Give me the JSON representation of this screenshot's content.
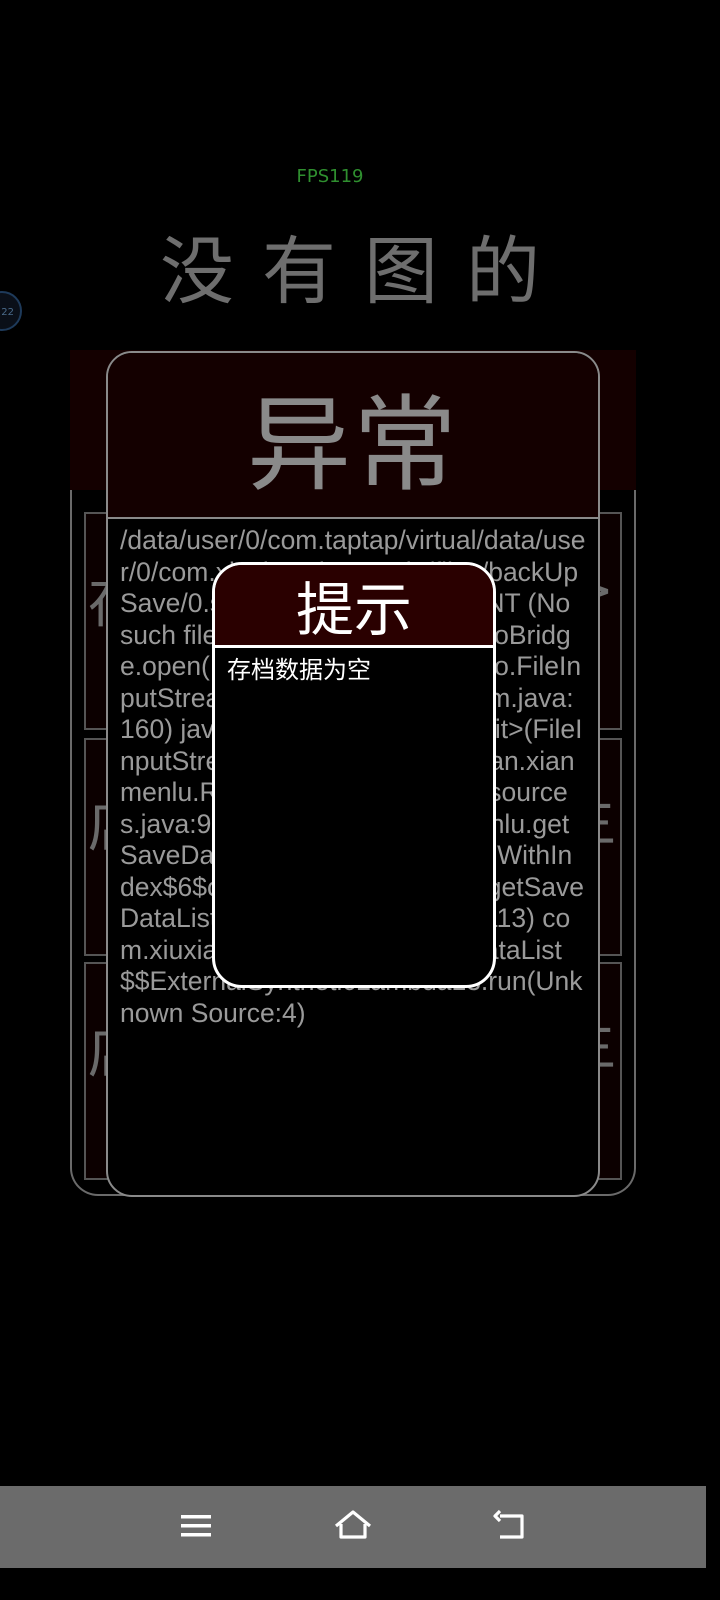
{
  "status": {
    "fps": "FPS119",
    "side_badge": "22"
  },
  "background": {
    "title": "没有图的",
    "cards": [
      {
        "left_char": "存",
        "right_char": ">"
      },
      {
        "left_char": "店",
        "right_char": "主"
      },
      {
        "left_char": "店",
        "right_char": "主"
      }
    ]
  },
  "error_panel": {
    "title": "异常",
    "message": "/data/user/0/com.taptap/virtual/data/user/0/com.xiuxian.xianmenlu/files/backUpSave/0.sav: open failed: ENOENT (No such file or directory) libcore.io.IoBridge.open(IoBridge.java:574) java.io.FileInputStream.<init>(FileInputStream.java:160) java.io.FileInputStream.<init>(FileInputStream.java:115) com.xiuxian.xianmenlu.Resources.getPlayer(Resources.java:976) com.xiuxian.xianmenlu.getSaveDataList.lambda$loadSaveWithIndex$6$com-xiuxian-xianmenlu-getSaveDataList(getSaveDataList.java:113) com.xiuxian.xianmenlu.getSaveDataList$$ExternalSyntheticLambda13.run(Unknown Source:4)"
  },
  "dialog": {
    "title": "提示",
    "message": "存档数据为空"
  },
  "navbar": {
    "icons": [
      "menu-icon",
      "home-icon",
      "back-icon"
    ],
    "color": "#6b6b6b"
  }
}
